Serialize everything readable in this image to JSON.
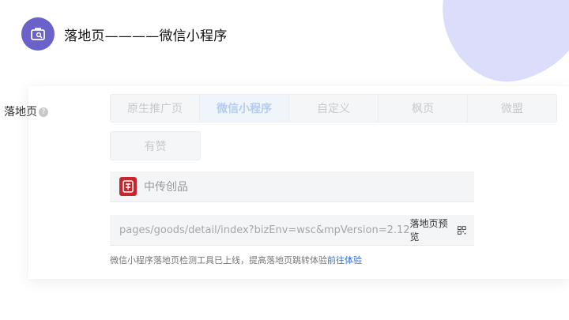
{
  "header": {
    "title": "落地页————微信小程序",
    "icon": "briefcase-search-icon",
    "accent": "#6a62c9"
  },
  "form": {
    "label": "落地页",
    "help_icon": "?"
  },
  "tabs": {
    "row1": [
      {
        "label": "原生推广页"
      },
      {
        "label": "微信小程序",
        "active": true
      },
      {
        "label": "自定义"
      },
      {
        "label": "枫页"
      },
      {
        "label": "微盟"
      }
    ],
    "row2": [
      {
        "label": "有赞"
      }
    ]
  },
  "shop": {
    "name": "中传创品",
    "logo_color": "#c9252c"
  },
  "path": {
    "value": "pages/goods/detail/index?bizEnv=wsc&mpVersion=2.12",
    "preview_label": "落地页预览",
    "preview_icon": "qrcode-icon"
  },
  "note": {
    "text": "微信小程序落地页检测工具已上线，提高落地页跳转体验",
    "link": "前往体验",
    "link_color": "#2f6fd6"
  }
}
